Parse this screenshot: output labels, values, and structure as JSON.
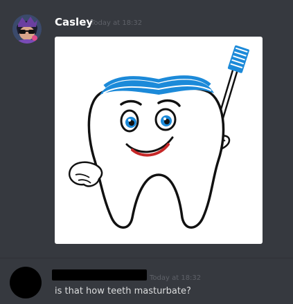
{
  "messages": [
    {
      "author": "Casley",
      "timestamp": "Today at 18:32",
      "attachment": {
        "icon": "tooth-with-toothbrush-illustration"
      }
    },
    {
      "author_redacted": true,
      "timestamp": "Today at 18:32",
      "text": "is that how teeth masturbate?"
    }
  ],
  "colors": {
    "background": "#36393f",
    "username": "#ffffff",
    "timestamp": "#5e6168",
    "message_text": "#dcddde",
    "tooth_blue": "#1c8ad9"
  }
}
